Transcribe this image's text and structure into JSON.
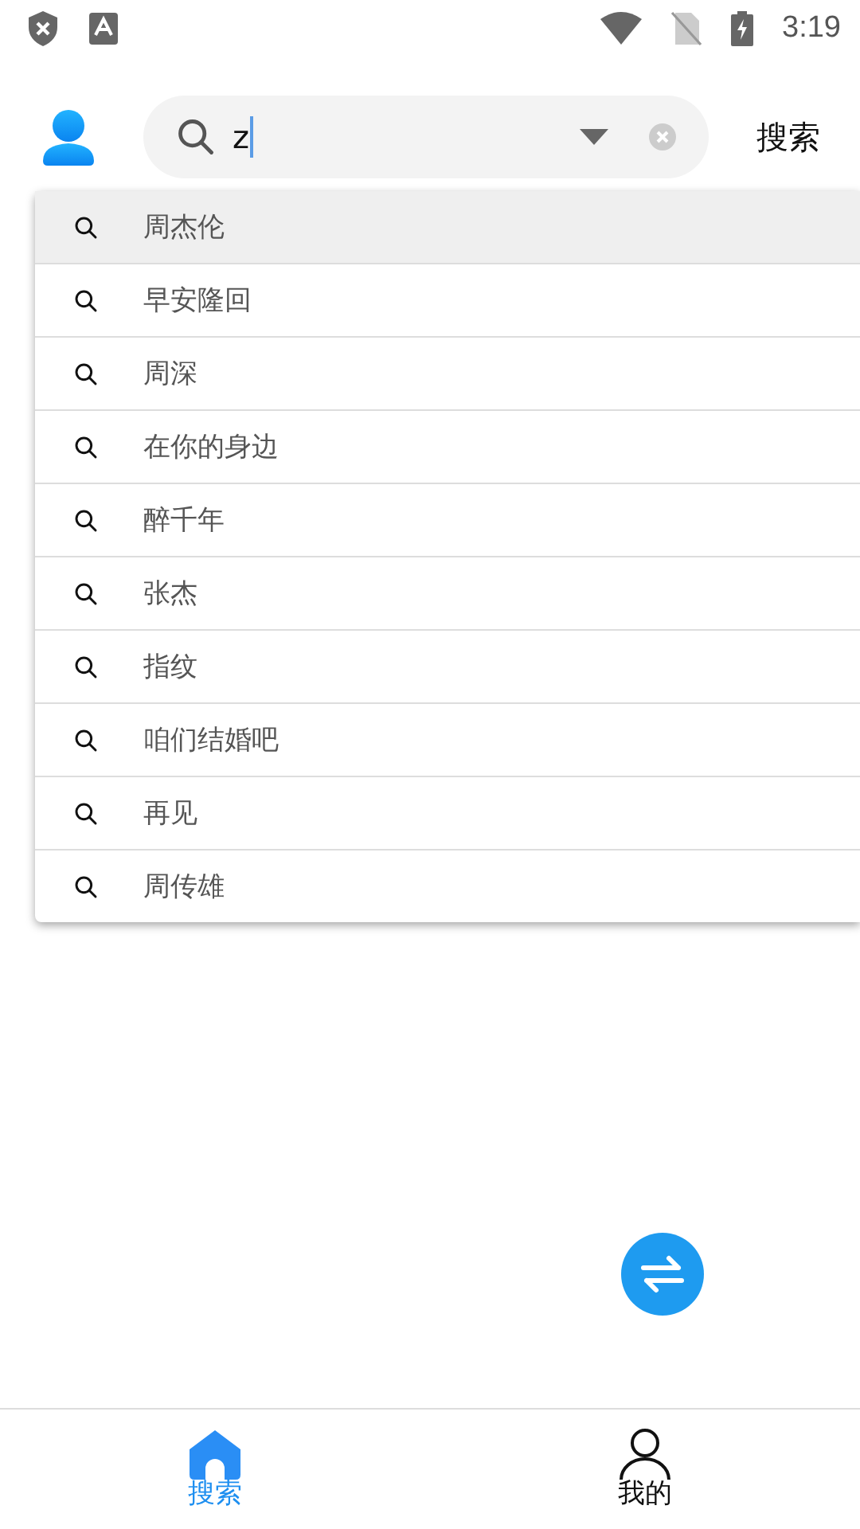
{
  "status_bar": {
    "time": "3:19"
  },
  "header": {
    "search": {
      "value": "z"
    },
    "search_button": "搜索"
  },
  "suggestions": [
    {
      "text": "周杰伦",
      "selected": true
    },
    {
      "text": "早安隆回",
      "selected": false
    },
    {
      "text": "周深",
      "selected": false
    },
    {
      "text": "在你的身边",
      "selected": false
    },
    {
      "text": "醉千年",
      "selected": false
    },
    {
      "text": "张杰",
      "selected": false
    },
    {
      "text": "指纹",
      "selected": false
    },
    {
      "text": "咱们结婚吧",
      "selected": false
    },
    {
      "text": "再见",
      "selected": false
    },
    {
      "text": "周传雄",
      "selected": false
    }
  ],
  "bottom_nav": [
    {
      "label": "搜索",
      "kind": "home",
      "selected": true
    },
    {
      "label": "我的",
      "kind": "profile",
      "selected": false
    }
  ]
}
